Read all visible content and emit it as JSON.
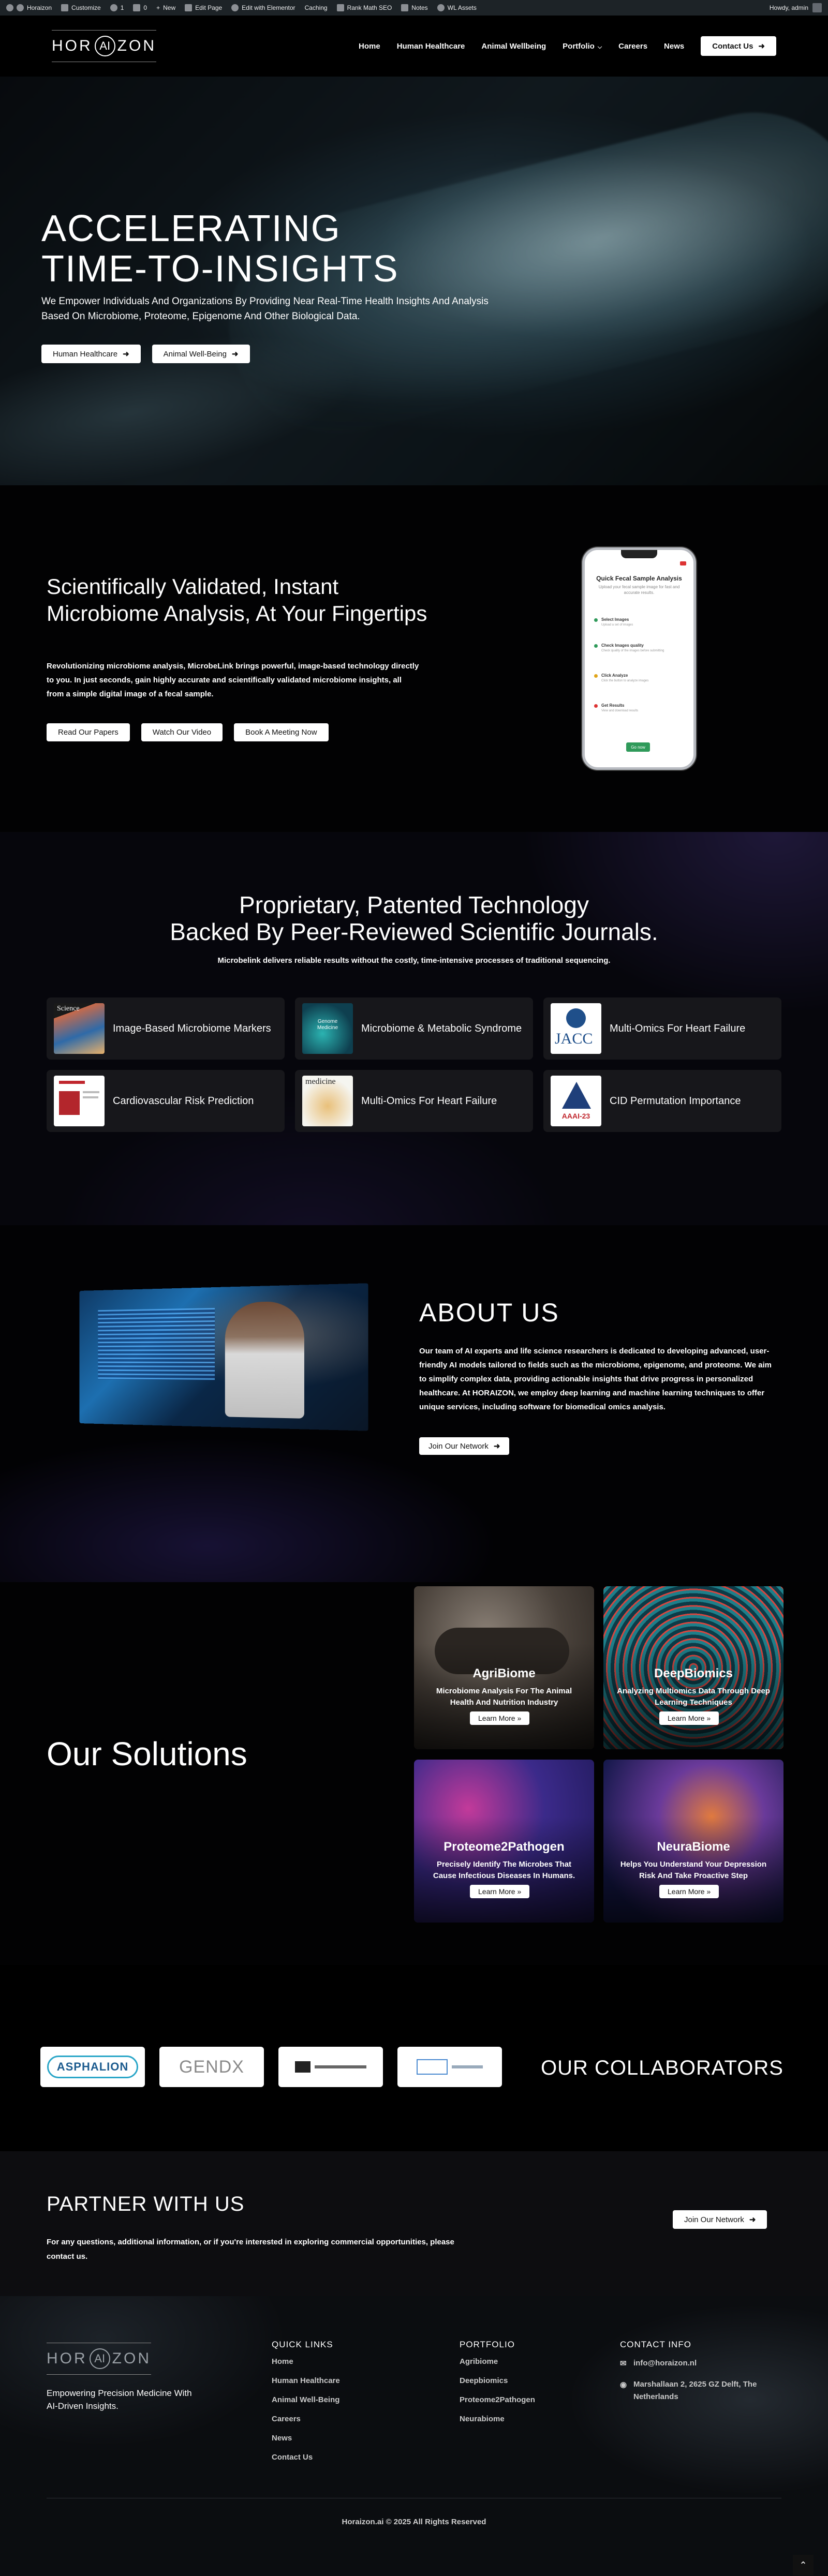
{
  "admin_bar": {
    "items": [
      "Horaizon",
      "Customize",
      "1",
      "0",
      "New",
      "Edit Page",
      "Edit with Elementor",
      "Caching",
      "Rank Math SEO",
      "Notes",
      "WL Assets"
    ],
    "greeting": "Howdy, admin"
  },
  "header": {
    "logo_text_left": "HOR",
    "logo_text_ring": "AI",
    "logo_text_right": "ZON",
    "nav": [
      "Home",
      "Human Healthcare",
      "Animal Wellbeing",
      "Portfolio",
      "Careers",
      "News"
    ],
    "cta": "Contact Us"
  },
  "hero": {
    "title_line1": "ACCELERATING",
    "title_line2": "TIME-TO-INSIGHTS",
    "subtitle": "We Empower Individuals And Organizations By Providing Near Real-Time Health Insights And Analysis Based On Microbiome, Proteome, Epigenome And Other Biological Data.",
    "btn1": "Human Healthcare",
    "btn2": "Animal Well-Being"
  },
  "validated": {
    "title": "Scientifically Validated, Instant Microbiome Analysis, At Your Fingertips",
    "body": "Revolutionizing microbiome analysis, MicrobeLink brings powerful, image-based technology directly to you. In just seconds, gain highly accurate and scientifically validated microbiome insights, all from a simple digital image of a fecal sample.",
    "btn1": "Read Our Papers",
    "btn2": "Watch Our Video",
    "btn3": "Book A Meeting Now",
    "phone": {
      "title": "Quick Fecal Sample Analysis",
      "subtitle": "Upload your fecal sample image for fast and accurate results.",
      "steps": [
        {
          "title": "Select Images",
          "desc": "Upload a set of images",
          "color": "#2f9a5a"
        },
        {
          "title": "Check Images quality",
          "desc": "Check quality of the images before submitting",
          "color": "#2f9a5a"
        },
        {
          "title": "Click Analyze",
          "desc": "Click the button to analyze images",
          "color": "#e0a419"
        },
        {
          "title": "Get Results",
          "desc": "View and download results",
          "color": "#d33"
        }
      ],
      "go": "Go now"
    }
  },
  "technology": {
    "title_line1": "Proprietary, Patented Technology",
    "title_line2": "Backed By Peer-Reviewed Scientific Journals.",
    "lead": "Microbelink delivers reliable results without the costly, time-intensive processes of traditional sequencing.",
    "cards": [
      {
        "title": "Image-Based Microbiome Markers",
        "thumb": "science-journal-thumb"
      },
      {
        "title": "Microbiome & Metabolic Syndrome",
        "thumb": "journal-teal-thumb"
      },
      {
        "title": "Multi-Omics For Heart Failure",
        "thumb": "jacc-logo-thumb"
      },
      {
        "title": "Cardiovascular Risk Prediction",
        "thumb": "paper-red-thumb"
      },
      {
        "title": "Multi-Omics For Heart Failure",
        "thumb": "medicine-journal-thumb"
      },
      {
        "title": "CID Permutation Importance",
        "thumb": "aaai-logo-thumb"
      }
    ],
    "thumb_labels": {
      "science": "Science",
      "journal2": "Genome Medicine",
      "jacc": "JACC",
      "medicine": "medicine",
      "aaai": "AAAI-23"
    }
  },
  "about": {
    "title": "ABOUT US",
    "body": "Our team of AI experts and life science researchers is dedicated to developing advanced, user-friendly AI models tailored to fields such as the microbiome, epigenome, and proteome. We aim to simplify complex data, providing actionable insights that drive progress in personalized healthcare. At HORAIZON, we employ deep learning and machine learning techniques to offer unique services, including software for biomedical omics analysis.",
    "cta": "Join Our Network"
  },
  "solutions": {
    "title": "Our Solutions",
    "items": [
      {
        "name": "AgriBiome",
        "desc": "Microbiome Analysis For The Animal Health And Nutrition Industry",
        "cta": "Learn More »"
      },
      {
        "name": "DeepBiomics",
        "desc": "Analyzing Multiomics Data Through Deep Learning Techniques",
        "cta": "Learn More »"
      },
      {
        "name": "Proteome2Pathogen",
        "desc": "Precisely Identify The Microbes That Cause Infectious Diseases In Humans.",
        "cta": "Learn More »"
      },
      {
        "name": "NeuraBiome",
        "desc": "Helps You Understand Your Depression Risk And Take Proactive Step",
        "cta": "Learn More »"
      }
    ]
  },
  "collaborators": {
    "title": "OUR COLLABORATORS",
    "logos": [
      "ASPHALION",
      "GENDX",
      "",
      ""
    ]
  },
  "partner": {
    "title": "PARTNER WITH US",
    "body": "For any questions, additional information, or if you're interested in exploring commercial opportunities, please contact us.",
    "cta": "Join Our Network"
  },
  "footer": {
    "tagline": "Empowering Precision Medicine With AI-Driven Insights.",
    "quick_links_title": "QUICK LINKS",
    "quick_links": [
      "Home",
      "Human Healthcare",
      "Animal Well-Being",
      "Careers",
      "News",
      "Contact Us"
    ],
    "portfolio_title": "PORTFOLIO",
    "portfolio": [
      "Agribiome",
      "Deepbiomics",
      "Proteome2Pathogen",
      "Neurabiome"
    ],
    "contact_title": "CONTACT INFO",
    "email": "info@horaizon.nl",
    "address": "Marshallaan 2, 2625 GZ Delft, The Netherlands",
    "copyright": "Horaizon.ai © 2025 All Rights Reserved"
  }
}
